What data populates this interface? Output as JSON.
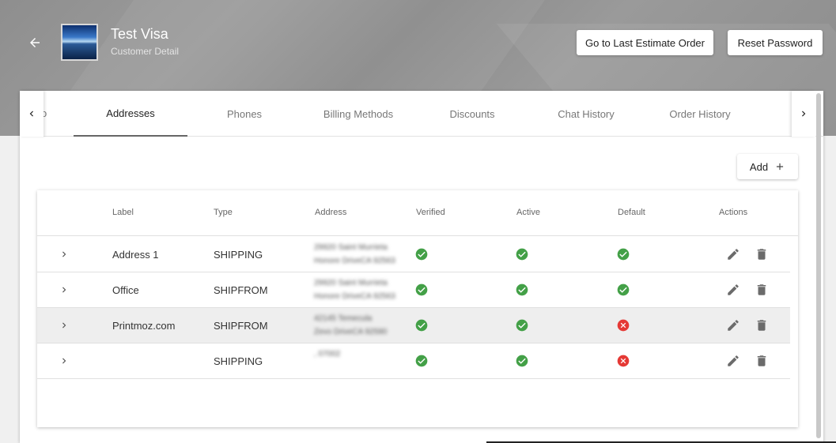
{
  "header": {
    "customer_name": "Test Visa",
    "customer_subtitle": "Customer Detail",
    "last_estimate_label": "Go to Last Estimate Order",
    "reset_password_label": "Reset Password"
  },
  "tabs": {
    "partial_left": "o",
    "items": [
      {
        "label": "Addresses"
      },
      {
        "label": "Phones"
      },
      {
        "label": "Billing Methods"
      },
      {
        "label": "Discounts"
      },
      {
        "label": "Chat History"
      },
      {
        "label": "Order History"
      }
    ],
    "active": "Addresses"
  },
  "add_label": "Add",
  "table": {
    "columns": [
      "Label",
      "Type",
      "Address",
      "Verified",
      "Active",
      "Default",
      "Actions"
    ],
    "rows": [
      {
        "label": "Address 1",
        "type": "SHIPPING",
        "address_line1": "29920 Saint Murrieta",
        "address_line2": "Honore DriveCA 92563",
        "verified": true,
        "active": true,
        "default": true
      },
      {
        "label": "Office",
        "type": "SHIPFROM",
        "address_line1": "29920 Saint Murrieta",
        "address_line2": "Honore DriveCA 92563",
        "verified": true,
        "active": true,
        "default": true
      },
      {
        "label": "Printmoz.com",
        "type": "SHIPFROM",
        "address_line1": "42145 Temecula",
        "address_line2": "Zevo DriveCA 92590",
        "verified": true,
        "active": true,
        "default": false
      },
      {
        "label": "",
        "type": "SHIPPING",
        "address_line1": ", 07002",
        "address_line2": "",
        "verified": true,
        "active": true,
        "default": false
      }
    ]
  },
  "colors": {
    "check": "#43a047",
    "cross": "#e53935",
    "action_icon": "#6b6b6b"
  }
}
